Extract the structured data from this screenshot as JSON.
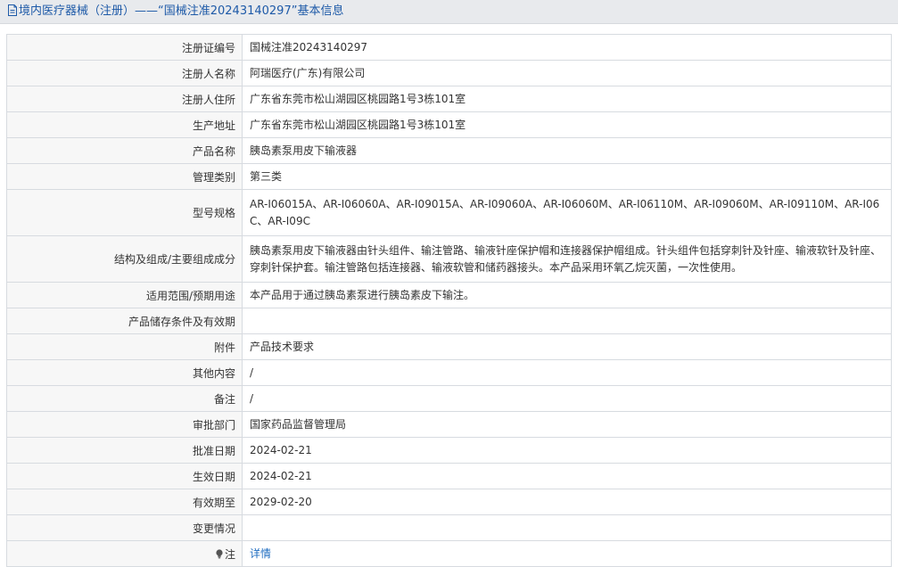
{
  "header": {
    "title": "境内医疗器械（注册）——“国械注准20243140297”基本信息",
    "icon": "document-icon",
    "color": "#1e5aa8"
  },
  "rows": [
    {
      "label": "注册证编号",
      "value": "国械注准20243140297"
    },
    {
      "label": "注册人名称",
      "value": "阿瑞医疗(广东)有限公司"
    },
    {
      "label": "注册人住所",
      "value": "广东省东莞市松山湖园区桃园路1号3栋101室"
    },
    {
      "label": "生产地址",
      "value": "广东省东莞市松山湖园区桃园路1号3栋101室"
    },
    {
      "label": "产品名称",
      "value": "胰岛素泵用皮下输液器"
    },
    {
      "label": "管理类别",
      "value": "第三类"
    },
    {
      "label": "型号规格",
      "value": "AR-I06015A、AR-I06060A、AR-I09015A、AR-I09060A、AR-I06060M、AR-I06110M、AR-I09060M、AR-I09110M、AR-I06C、AR-I09C"
    },
    {
      "label": "结构及组成/主要组成成分",
      "value": "胰岛素泵用皮下输液器由针头组件、输注管路、输液针座保护帽和连接器保护帽组成。针头组件包括穿刺针及针座、输液软针及针座、穿刺针保护套。输注管路包括连接器、输液软管和储药器接头。本产品采用环氧乙烷灭菌，一次性使用。"
    },
    {
      "label": "适用范围/预期用途",
      "value": "本产品用于通过胰岛素泵进行胰岛素皮下输注。"
    },
    {
      "label": "产品储存条件及有效期",
      "value": ""
    },
    {
      "label": "附件",
      "value": "产品技术要求"
    },
    {
      "label": "其他内容",
      "value": "/"
    },
    {
      "label": "备注",
      "value": "/"
    },
    {
      "label": "审批部门",
      "value": "国家药品监督管理局"
    },
    {
      "label": "批准日期",
      "value": "2024-02-21"
    },
    {
      "label": "生效日期",
      "value": "2024-02-21"
    },
    {
      "label": "有效期至",
      "value": "2029-02-20"
    },
    {
      "label": "变更情况",
      "value": ""
    }
  ],
  "note": {
    "label": "注",
    "icon": "lightbulb-icon",
    "link_text": "详情",
    "link_color": "#1e6cc0"
  }
}
